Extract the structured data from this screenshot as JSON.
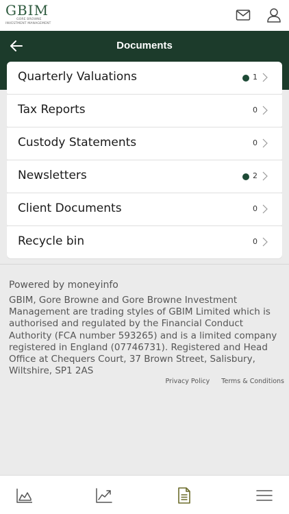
{
  "brand": {
    "name": "GBIM",
    "sub_line1": "GORE BROWNE",
    "sub_line2": "INVESTMENT MANAGEMENT"
  },
  "header": {
    "title": "Documents"
  },
  "documents": [
    {
      "label": "Quarterly Valuations",
      "count": "1",
      "unread": true
    },
    {
      "label": "Tax Reports",
      "count": "0",
      "unread": false
    },
    {
      "label": "Custody Statements",
      "count": "0",
      "unread": false
    },
    {
      "label": "Newsletters",
      "count": "2",
      "unread": true
    },
    {
      "label": "Client Documents",
      "count": "0",
      "unread": false
    },
    {
      "label": "Recycle bin",
      "count": "0",
      "unread": false
    }
  ],
  "footer": {
    "powered_by": "Powered by moneyinfo",
    "legal": "GBIM, Gore Browne and Gore Browne Investment Management are trading styles of GBIM Limited which is authorised and regulated by the Financial Conduct Authority (FCA number 593265) and is a limited company registered in England (07746731). Registered and Head Office at Chequers Court, 37 Brown Street, Salisbury, Wiltshire, SP1 2AS",
    "privacy_policy": "Privacy Policy",
    "terms": "Terms & Conditions"
  },
  "icons": {
    "top": [
      "mail-icon",
      "user-icon"
    ],
    "nav": [
      "area-chart-icon",
      "trend-chart-icon",
      "document-icon",
      "menu-icon"
    ]
  },
  "colors": {
    "brand_green": "#1c3b2b",
    "logo_green": "#2e5a3e",
    "unread_dot": "#1e4a36",
    "background": "#ebebeb"
  }
}
